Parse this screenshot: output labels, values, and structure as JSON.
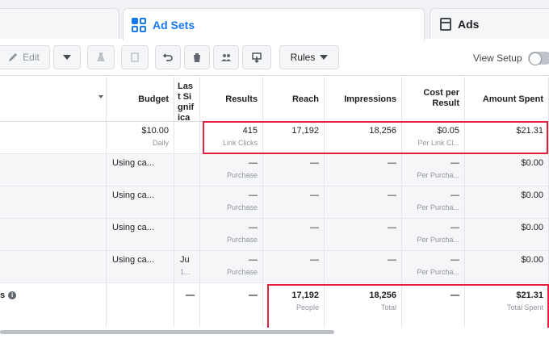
{
  "tabs": {
    "adsets": "Ad Sets",
    "ads": "Ads"
  },
  "toolbar": {
    "edit": "Edit",
    "rules": "Rules",
    "view_setup": "View Setup"
  },
  "columns": {
    "budget": "Budget",
    "last_sig": "Last Significant Edit",
    "results": "Results",
    "reach": "Reach",
    "impressions": "Impressions",
    "cost_per_result": "Cost per Result",
    "amount_spent": "Amount Spent"
  },
  "rows": [
    {
      "budget": "$10.00",
      "budget_sub": "Daily",
      "last_sig": "",
      "last_sig_sub": "",
      "results": "415",
      "results_sub": "Link Clicks",
      "reach": "17,192",
      "impressions": "18,256",
      "cost": "$0.05",
      "cost_sub": "Per Link Cl...",
      "spent": "$21.31"
    },
    {
      "budget": "Using ca...",
      "budget_sub": "",
      "last_sig": "",
      "last_sig_sub": "",
      "results": "—",
      "results_sub": "Purchase",
      "reach": "—",
      "impressions": "—",
      "cost": "—",
      "cost_sub": "Per Purcha...",
      "spent": "$0.00"
    },
    {
      "budget": "Using ca...",
      "budget_sub": "",
      "last_sig": "",
      "last_sig_sub": "",
      "results": "—",
      "results_sub": "Purchase",
      "reach": "—",
      "impressions": "—",
      "cost": "—",
      "cost_sub": "Per Purcha...",
      "spent": "$0.00"
    },
    {
      "budget": "Using ca...",
      "budget_sub": "",
      "last_sig": "",
      "last_sig_sub": "",
      "results": "—",
      "results_sub": "Purchase",
      "reach": "—",
      "impressions": "—",
      "cost": "—",
      "cost_sub": "Per Purcha...",
      "spent": "$0.00"
    },
    {
      "budget": "Using ca...",
      "budget_sub": "",
      "last_sig": "Ju",
      "last_sig_sub": "1...",
      "results": "—",
      "results_sub": "Purchase",
      "reach": "—",
      "impressions": "—",
      "cost": "—",
      "cost_sub": "Per Purcha...",
      "spent": "$0.00"
    }
  ],
  "totals": {
    "label": "s",
    "info_icon": "i",
    "budget": "",
    "last_sig": "—",
    "results": "—",
    "reach": "17,192",
    "reach_sub": "People",
    "impressions": "18,256",
    "impressions_sub": "Total",
    "cost": "—",
    "spent": "$21.31",
    "spent_sub": "Total Spent"
  },
  "highlight_color": "#e41e3f",
  "accent_color": "#1877f2"
}
